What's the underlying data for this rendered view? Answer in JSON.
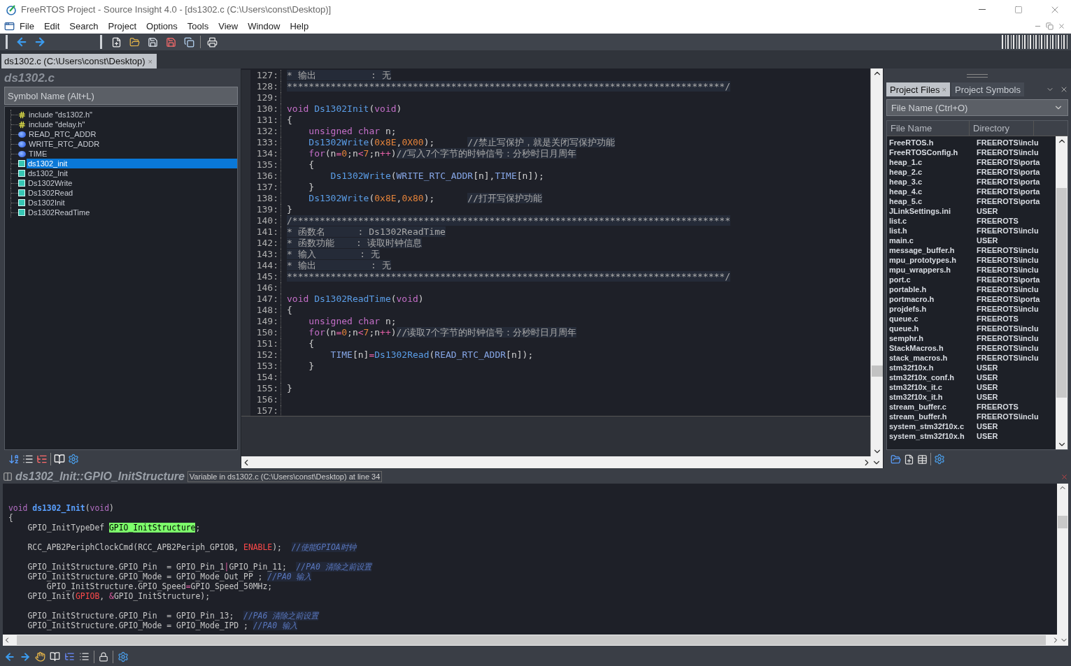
{
  "window": {
    "title": "FreeRTOS Project - Source Insight 4.0 - [ds1302.c (C:\\Users\\const\\Desktop)]"
  },
  "menu": [
    "File",
    "Edit",
    "Search",
    "Project",
    "Options",
    "Tools",
    "View",
    "Window",
    "Help"
  ],
  "document_tab": {
    "label": "ds1302.c (C:\\Users\\const\\Desktop)",
    "close": "×"
  },
  "symbol_panel": {
    "title": "ds1302.c",
    "search": {
      "placeholder": "Symbol Name (Alt+L)"
    },
    "items": [
      {
        "kind": "include",
        "label": "include \"ds1302.h\"",
        "selected": false
      },
      {
        "kind": "include",
        "label": "include \"delay.h\"",
        "selected": false
      },
      {
        "kind": "macro",
        "label": "READ_RTC_ADDR",
        "selected": false
      },
      {
        "kind": "macro",
        "label": "WRITE_RTC_ADDR",
        "selected": false
      },
      {
        "kind": "macro",
        "label": "TIME",
        "selected": false
      },
      {
        "kind": "function",
        "label": "ds1302_init",
        "selected": true
      },
      {
        "kind": "function",
        "label": "ds1302_Init",
        "selected": false
      },
      {
        "kind": "function",
        "label": "Ds1302Write",
        "selected": false
      },
      {
        "kind": "function",
        "label": "Ds1302Read",
        "selected": false
      },
      {
        "kind": "function",
        "label": "Ds1302Init",
        "selected": false
      },
      {
        "kind": "function",
        "label": "Ds1302ReadTime",
        "selected": false
      }
    ]
  },
  "editor": {
    "lines": [
      {
        "number": "127:",
        "tokens": [
          {
            "kind": "comment",
            "text": "* 输出          : 无"
          }
        ]
      },
      {
        "number": "128:",
        "tokens": [
          {
            "kind": "comment",
            "text": "********************************************************************************/"
          }
        ]
      },
      {
        "number": "129:"
      },
      {
        "number": "130:",
        "tokens": [
          {
            "kind": "keyword",
            "text": "void "
          },
          {
            "kind": "function",
            "text": "Ds1302Init"
          },
          {
            "kind": "plain",
            "text": "("
          },
          {
            "kind": "keyword",
            "text": "void"
          },
          {
            "kind": "plain",
            "text": ")"
          }
        ]
      },
      {
        "number": "131:",
        "tokens": [
          {
            "kind": "plain",
            "text": "{"
          }
        ]
      },
      {
        "number": "132:",
        "tokens": [
          {
            "kind": "keyword",
            "text": "    unsigned char"
          },
          {
            "kind": "plain",
            "text": " n;"
          }
        ]
      },
      {
        "number": "133:",
        "tokens": [
          {
            "kind": "function",
            "text": "    Ds1302Write"
          },
          {
            "kind": "plain",
            "text": "("
          },
          {
            "kind": "number",
            "text": "0x8E"
          },
          {
            "kind": "plain",
            "text": ","
          },
          {
            "kind": "number",
            "text": "0X00"
          },
          {
            "kind": "plain",
            "text": ");      "
          },
          {
            "kind": "comment",
            "text": "//禁止写保护，就是关闭写保护功能"
          }
        ]
      },
      {
        "number": "134:",
        "tokens": [
          {
            "kind": "keyword",
            "text": "    for"
          },
          {
            "kind": "plain",
            "text": "(n"
          },
          {
            "kind": "operator",
            "text": "="
          },
          {
            "kind": "number",
            "text": "0"
          },
          {
            "kind": "plain",
            "text": ";n"
          },
          {
            "kind": "operator",
            "text": "<"
          },
          {
            "kind": "number",
            "text": "7"
          },
          {
            "kind": "plain",
            "text": ";n"
          },
          {
            "kind": "operator",
            "text": "++"
          },
          {
            "kind": "plain",
            "text": ")"
          },
          {
            "kind": "comment",
            "text": "//写入7个字节的时钟信号：分秒时日月周年"
          }
        ]
      },
      {
        "number": "135:",
        "tokens": [
          {
            "kind": "plain",
            "text": "    {"
          }
        ]
      },
      {
        "number": "136:",
        "tokens": [
          {
            "kind": "function",
            "text": "        Ds1302Write"
          },
          {
            "kind": "plain",
            "text": "("
          },
          {
            "kind": "variable",
            "text": "WRITE_RTC_ADDR"
          },
          {
            "kind": "plain",
            "text": "[n],"
          },
          {
            "kind": "variable",
            "text": "TIME"
          },
          {
            "kind": "plain",
            "text": "[n]);"
          }
        ]
      },
      {
        "number": "137:",
        "tokens": [
          {
            "kind": "plain",
            "text": "    }"
          }
        ]
      },
      {
        "number": "138:",
        "tokens": [
          {
            "kind": "function",
            "text": "    Ds1302Write"
          },
          {
            "kind": "plain",
            "text": "("
          },
          {
            "kind": "number",
            "text": "0x8E"
          },
          {
            "kind": "plain",
            "text": ","
          },
          {
            "kind": "number",
            "text": "0x80"
          },
          {
            "kind": "plain",
            "text": ");      "
          },
          {
            "kind": "comment",
            "text": "//打开写保护功能"
          }
        ]
      },
      {
        "number": "139:",
        "tokens": [
          {
            "kind": "plain",
            "text": "}"
          }
        ]
      },
      {
        "number": "140:",
        "tokens": [
          {
            "kind": "comment",
            "text": "/********************************************************************************"
          }
        ]
      },
      {
        "number": "141:",
        "tokens": [
          {
            "kind": "comment",
            "text": "* 函数名      : Ds1302ReadTime"
          }
        ]
      },
      {
        "number": "142:",
        "tokens": [
          {
            "kind": "comment",
            "text": "* 函数功能    : 读取时钟信息"
          }
        ]
      },
      {
        "number": "143:",
        "tokens": [
          {
            "kind": "comment",
            "text": "* 输入        : 无"
          }
        ]
      },
      {
        "number": "144:",
        "tokens": [
          {
            "kind": "comment",
            "text": "* 输出          : 无"
          }
        ]
      },
      {
        "number": "145:",
        "tokens": [
          {
            "kind": "comment",
            "text": "********************************************************************************/"
          }
        ]
      },
      {
        "number": "146:"
      },
      {
        "number": "147:",
        "tokens": [
          {
            "kind": "keyword",
            "text": "void "
          },
          {
            "kind": "function",
            "text": "Ds1302ReadTime"
          },
          {
            "kind": "plain",
            "text": "("
          },
          {
            "kind": "keyword",
            "text": "void"
          },
          {
            "kind": "plain",
            "text": ")"
          }
        ]
      },
      {
        "number": "148:",
        "tokens": [
          {
            "kind": "plain",
            "text": "{"
          }
        ]
      },
      {
        "number": "149:",
        "tokens": [
          {
            "kind": "keyword",
            "text": "    unsigned char"
          },
          {
            "kind": "plain",
            "text": " n;"
          }
        ]
      },
      {
        "number": "150:",
        "tokens": [
          {
            "kind": "keyword",
            "text": "    for"
          },
          {
            "kind": "plain",
            "text": "(n"
          },
          {
            "kind": "operator",
            "text": "="
          },
          {
            "kind": "number",
            "text": "0"
          },
          {
            "kind": "plain",
            "text": ";n"
          },
          {
            "kind": "operator",
            "text": "<"
          },
          {
            "kind": "number",
            "text": "7"
          },
          {
            "kind": "plain",
            "text": ";n"
          },
          {
            "kind": "operator",
            "text": "++"
          },
          {
            "kind": "plain",
            "text": ")"
          },
          {
            "kind": "comment",
            "text": "//读取7个字节的时钟信号：分秒时日月周年"
          }
        ]
      },
      {
        "number": "151:",
        "tokens": [
          {
            "kind": "plain",
            "text": "    {"
          }
        ]
      },
      {
        "number": "152:",
        "tokens": [
          {
            "kind": "variable",
            "text": "        TIME"
          },
          {
            "kind": "plain",
            "text": "[n]"
          },
          {
            "kind": "operator",
            "text": "="
          },
          {
            "kind": "function",
            "text": "Ds1302Read"
          },
          {
            "kind": "plain",
            "text": "("
          },
          {
            "kind": "variable",
            "text": "READ_RTC_ADDR"
          },
          {
            "kind": "plain",
            "text": "[n]);"
          }
        ]
      },
      {
        "number": "153:",
        "tokens": [
          {
            "kind": "plain",
            "text": "    }"
          }
        ]
      },
      {
        "number": "154:"
      },
      {
        "number": "155:",
        "tokens": [
          {
            "kind": "plain",
            "text": "}"
          }
        ]
      },
      {
        "number": "156:"
      },
      {
        "number": "157:"
      }
    ]
  },
  "project_panel": {
    "tabs": [
      {
        "label": "Project Files",
        "close": "×",
        "selected": true
      },
      {
        "label": "Project Symbols",
        "selected": false
      }
    ],
    "search": {
      "placeholder": "File Name (Ctrl+O)"
    },
    "columns": [
      "File Name",
      "Directory"
    ],
    "rows": [
      {
        "name": "FreeRTOS.h",
        "directory": "FREEROTS\\inclu"
      },
      {
        "name": "FreeRTOSConfig.h",
        "directory": "FREEROTS\\inclu"
      },
      {
        "name": "heap_1.c",
        "directory": "FREEROTS\\porta"
      },
      {
        "name": "heap_2.c",
        "directory": "FREEROTS\\porta"
      },
      {
        "name": "heap_3.c",
        "directory": "FREEROTS\\porta"
      },
      {
        "name": "heap_4.c",
        "directory": "FREEROTS\\porta"
      },
      {
        "name": "heap_5.c",
        "directory": "FREEROTS\\porta"
      },
      {
        "name": "JLinkSettings.ini",
        "directory": "USER"
      },
      {
        "name": "list.c",
        "directory": "FREEROTS"
      },
      {
        "name": "list.h",
        "directory": "FREEROTS\\inclu"
      },
      {
        "name": "main.c",
        "directory": "USER"
      },
      {
        "name": "message_buffer.h",
        "directory": "FREEROTS\\inclu"
      },
      {
        "name": "mpu_prototypes.h",
        "directory": "FREEROTS\\inclu"
      },
      {
        "name": "mpu_wrappers.h",
        "directory": "FREEROTS\\inclu"
      },
      {
        "name": "port.c",
        "directory": "FREEROTS\\porta"
      },
      {
        "name": "portable.h",
        "directory": "FREEROTS\\inclu"
      },
      {
        "name": "portmacro.h",
        "directory": "FREEROTS\\porta"
      },
      {
        "name": "projdefs.h",
        "directory": "FREEROTS\\inclu"
      },
      {
        "name": "queue.c",
        "directory": "FREEROTS"
      },
      {
        "name": "queue.h",
        "directory": "FREEROTS\\inclu"
      },
      {
        "name": "semphr.h",
        "directory": "FREEROTS\\inclu"
      },
      {
        "name": "StackMacros.h",
        "directory": "FREEROTS\\inclu"
      },
      {
        "name": "stack_macros.h",
        "directory": "FREEROTS\\inclu"
      },
      {
        "name": "stm32f10x.h",
        "directory": "USER"
      },
      {
        "name": "stm32f10x_conf.h",
        "directory": "USER"
      },
      {
        "name": "stm32f10x_it.c",
        "directory": "USER"
      },
      {
        "name": "stm32f10x_it.h",
        "directory": "USER"
      },
      {
        "name": "stream_buffer.c",
        "directory": "FREEROTS"
      },
      {
        "name": "stream_buffer.h",
        "directory": "FREEROTS\\inclu"
      },
      {
        "name": "system_stm32f10x.c",
        "directory": "USER"
      },
      {
        "name": "system_stm32f10x.h",
        "directory": "USER"
      }
    ]
  },
  "context_window": {
    "title": "ds1302_Init::GPIO_InitStructure",
    "subtitle": "Variable in ds1302.c (C:\\Users\\const\\Desktop) at line 34",
    "lines": [
      {
        "kind": "code",
        "tokens": [
          {
            "kind": "keyword",
            "text": "void "
          },
          {
            "kind": "definition",
            "text": "ds1302_Init"
          },
          {
            "kind": "plain",
            "text": "("
          },
          {
            "kind": "keyword",
            "text": "void"
          },
          {
            "kind": "plain",
            "text": ")"
          }
        ]
      },
      {
        "kind": "code",
        "tokens": [
          {
            "kind": "plain",
            "text": "{"
          }
        ]
      },
      {
        "kind": "code",
        "tokens": [
          {
            "kind": "plain",
            "text": "    GPIO_InitTypeDef "
          },
          {
            "kind": "highlight",
            "text": "GPIO_InitStructure"
          },
          {
            "kind": "plain",
            "text": ";"
          }
        ]
      },
      {
        "kind": "blank"
      },
      {
        "kind": "code",
        "tokens": [
          {
            "kind": "plain",
            "text": "    RCC_APB2PeriphClockCmd(RCC_APB2Periph_GPIOB, "
          },
          {
            "kind": "macro",
            "text": "ENABLE"
          },
          {
            "kind": "plain",
            "text": ");  "
          },
          {
            "kind": "comment",
            "text": "//使能GPIOA时钟"
          }
        ]
      },
      {
        "kind": "blank"
      },
      {
        "kind": "code",
        "tokens": [
          {
            "kind": "plain",
            "text": "    GPIO_InitStructure.GPIO_Pin  = GPIO_Pin_1"
          },
          {
            "kind": "operator",
            "text": "|"
          },
          {
            "kind": "plain",
            "text": "GPIO_Pin_11;  "
          },
          {
            "kind": "comment",
            "text": "//PA0 清除之前设置"
          }
        ]
      },
      {
        "kind": "code",
        "tokens": [
          {
            "kind": "plain",
            "text": "    GPIO_InitStructure.GPIO_Mode = GPIO_Mode_Out_PP ; "
          },
          {
            "kind": "comment",
            "text": "//PA0 输入"
          }
        ]
      },
      {
        "kind": "code",
        "tokens": [
          {
            "kind": "plain",
            "text": "        GPIO_InitStructure.GPIO_Speed"
          },
          {
            "kind": "operator",
            "text": "="
          },
          {
            "kind": "plain",
            "text": "GPIO_Speed_50MHz;"
          }
        ]
      },
      {
        "kind": "code",
        "tokens": [
          {
            "kind": "plain",
            "text": "    GPIO_Init("
          },
          {
            "kind": "macro",
            "text": "GPIOB"
          },
          {
            "kind": "plain",
            "text": ", "
          },
          {
            "kind": "operator",
            "text": "&"
          },
          {
            "kind": "plain",
            "text": "GPIO_InitStructure);"
          }
        ]
      },
      {
        "kind": "blank"
      },
      {
        "kind": "code",
        "tokens": [
          {
            "kind": "plain",
            "text": "    GPIO_InitStructure.GPIO_Pin  = GPIO_Pin_13;  "
          },
          {
            "kind": "comment",
            "text": "//PA6 清除之前设置"
          }
        ]
      },
      {
        "kind": "code",
        "tokens": [
          {
            "kind": "plain",
            "text": "    GPIO_InitStructure.GPIO_Mode = GPIO_Mode_IPD ; "
          },
          {
            "kind": "comment",
            "text": "//PA0 输入"
          }
        ]
      }
    ]
  }
}
